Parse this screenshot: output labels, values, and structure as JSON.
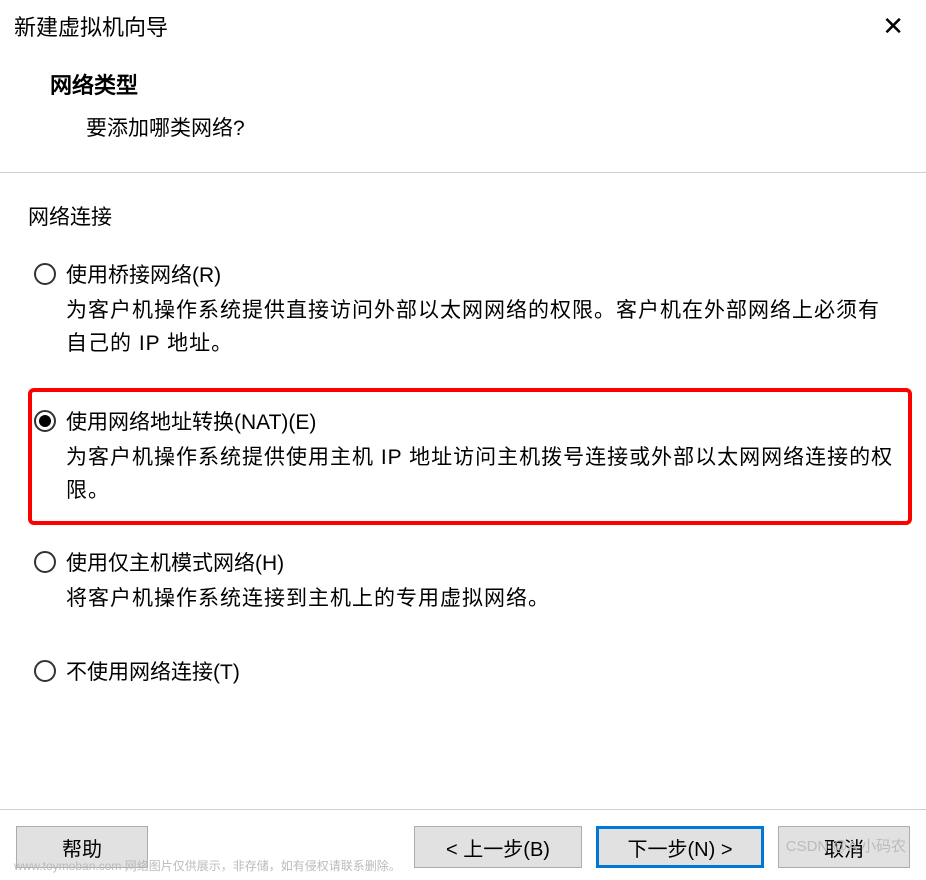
{
  "titlebar": {
    "title": "新建虚拟机向导"
  },
  "header": {
    "title": "网络类型",
    "subtitle": "要添加哪类网络?"
  },
  "fieldset": {
    "legend": "网络连接",
    "options": [
      {
        "label": "使用桥接网络(R)",
        "description": "为客户机操作系统提供直接访问外部以太网网络的权限。客户机在外部网络上必须有自己的 IP 地址。",
        "selected": false
      },
      {
        "label": "使用网络地址转换(NAT)(E)",
        "description": "为客户机操作系统提供使用主机 IP 地址访问主机拨号连接或外部以太网网络连接的权限。",
        "selected": true
      },
      {
        "label": "使用仅主机模式网络(H)",
        "description": "将客户机操作系统连接到主机上的专用虚拟网络。",
        "selected": false
      },
      {
        "label": "不使用网络连接(T)",
        "description": "",
        "selected": false
      }
    ]
  },
  "buttons": {
    "help": "帮助",
    "back": "< 上一步(B)",
    "next": "下一步(N) >",
    "cancel": "取消"
  },
  "watermark": "www.toymoban.com 网络图片仅供展示，非存储，如有侵权请联系删除。",
  "watermark2": "CSDN @A 小码农"
}
